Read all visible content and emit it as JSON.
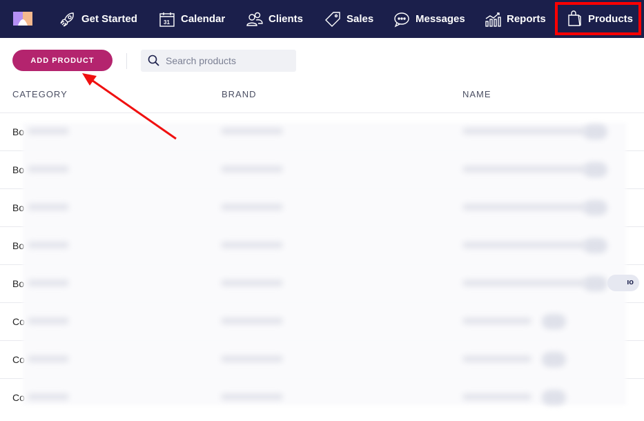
{
  "nav": {
    "items": [
      {
        "label": "Get Started",
        "icon": "rocket-icon"
      },
      {
        "label": "Calendar",
        "icon": "calendar-icon"
      },
      {
        "label": "Clients",
        "icon": "users-icon"
      },
      {
        "label": "Sales",
        "icon": "tag-icon"
      },
      {
        "label": "Messages",
        "icon": "chat-icon"
      },
      {
        "label": "Reports",
        "icon": "chart-icon"
      },
      {
        "label": "Products",
        "icon": "shopping-bag-icon",
        "active": true
      }
    ],
    "calendar_day": "31"
  },
  "toolbar": {
    "add_label": "ADD PRODUCT",
    "search_placeholder": "Search products"
  },
  "table": {
    "headers": [
      "CATEGORY",
      "BRAND",
      "NAME"
    ],
    "rows": [
      {
        "category": "Bo"
      },
      {
        "category": "Bo"
      },
      {
        "category": "Bo"
      },
      {
        "category": "Bo"
      },
      {
        "category": "Bo",
        "badge": "ıo"
      },
      {
        "category": "Co"
      },
      {
        "category": "Co"
      },
      {
        "category": "Co"
      }
    ]
  },
  "colors": {
    "nav_bg": "#1b1f4b",
    "accent": "#b4246e",
    "highlight": "#ff0000"
  }
}
